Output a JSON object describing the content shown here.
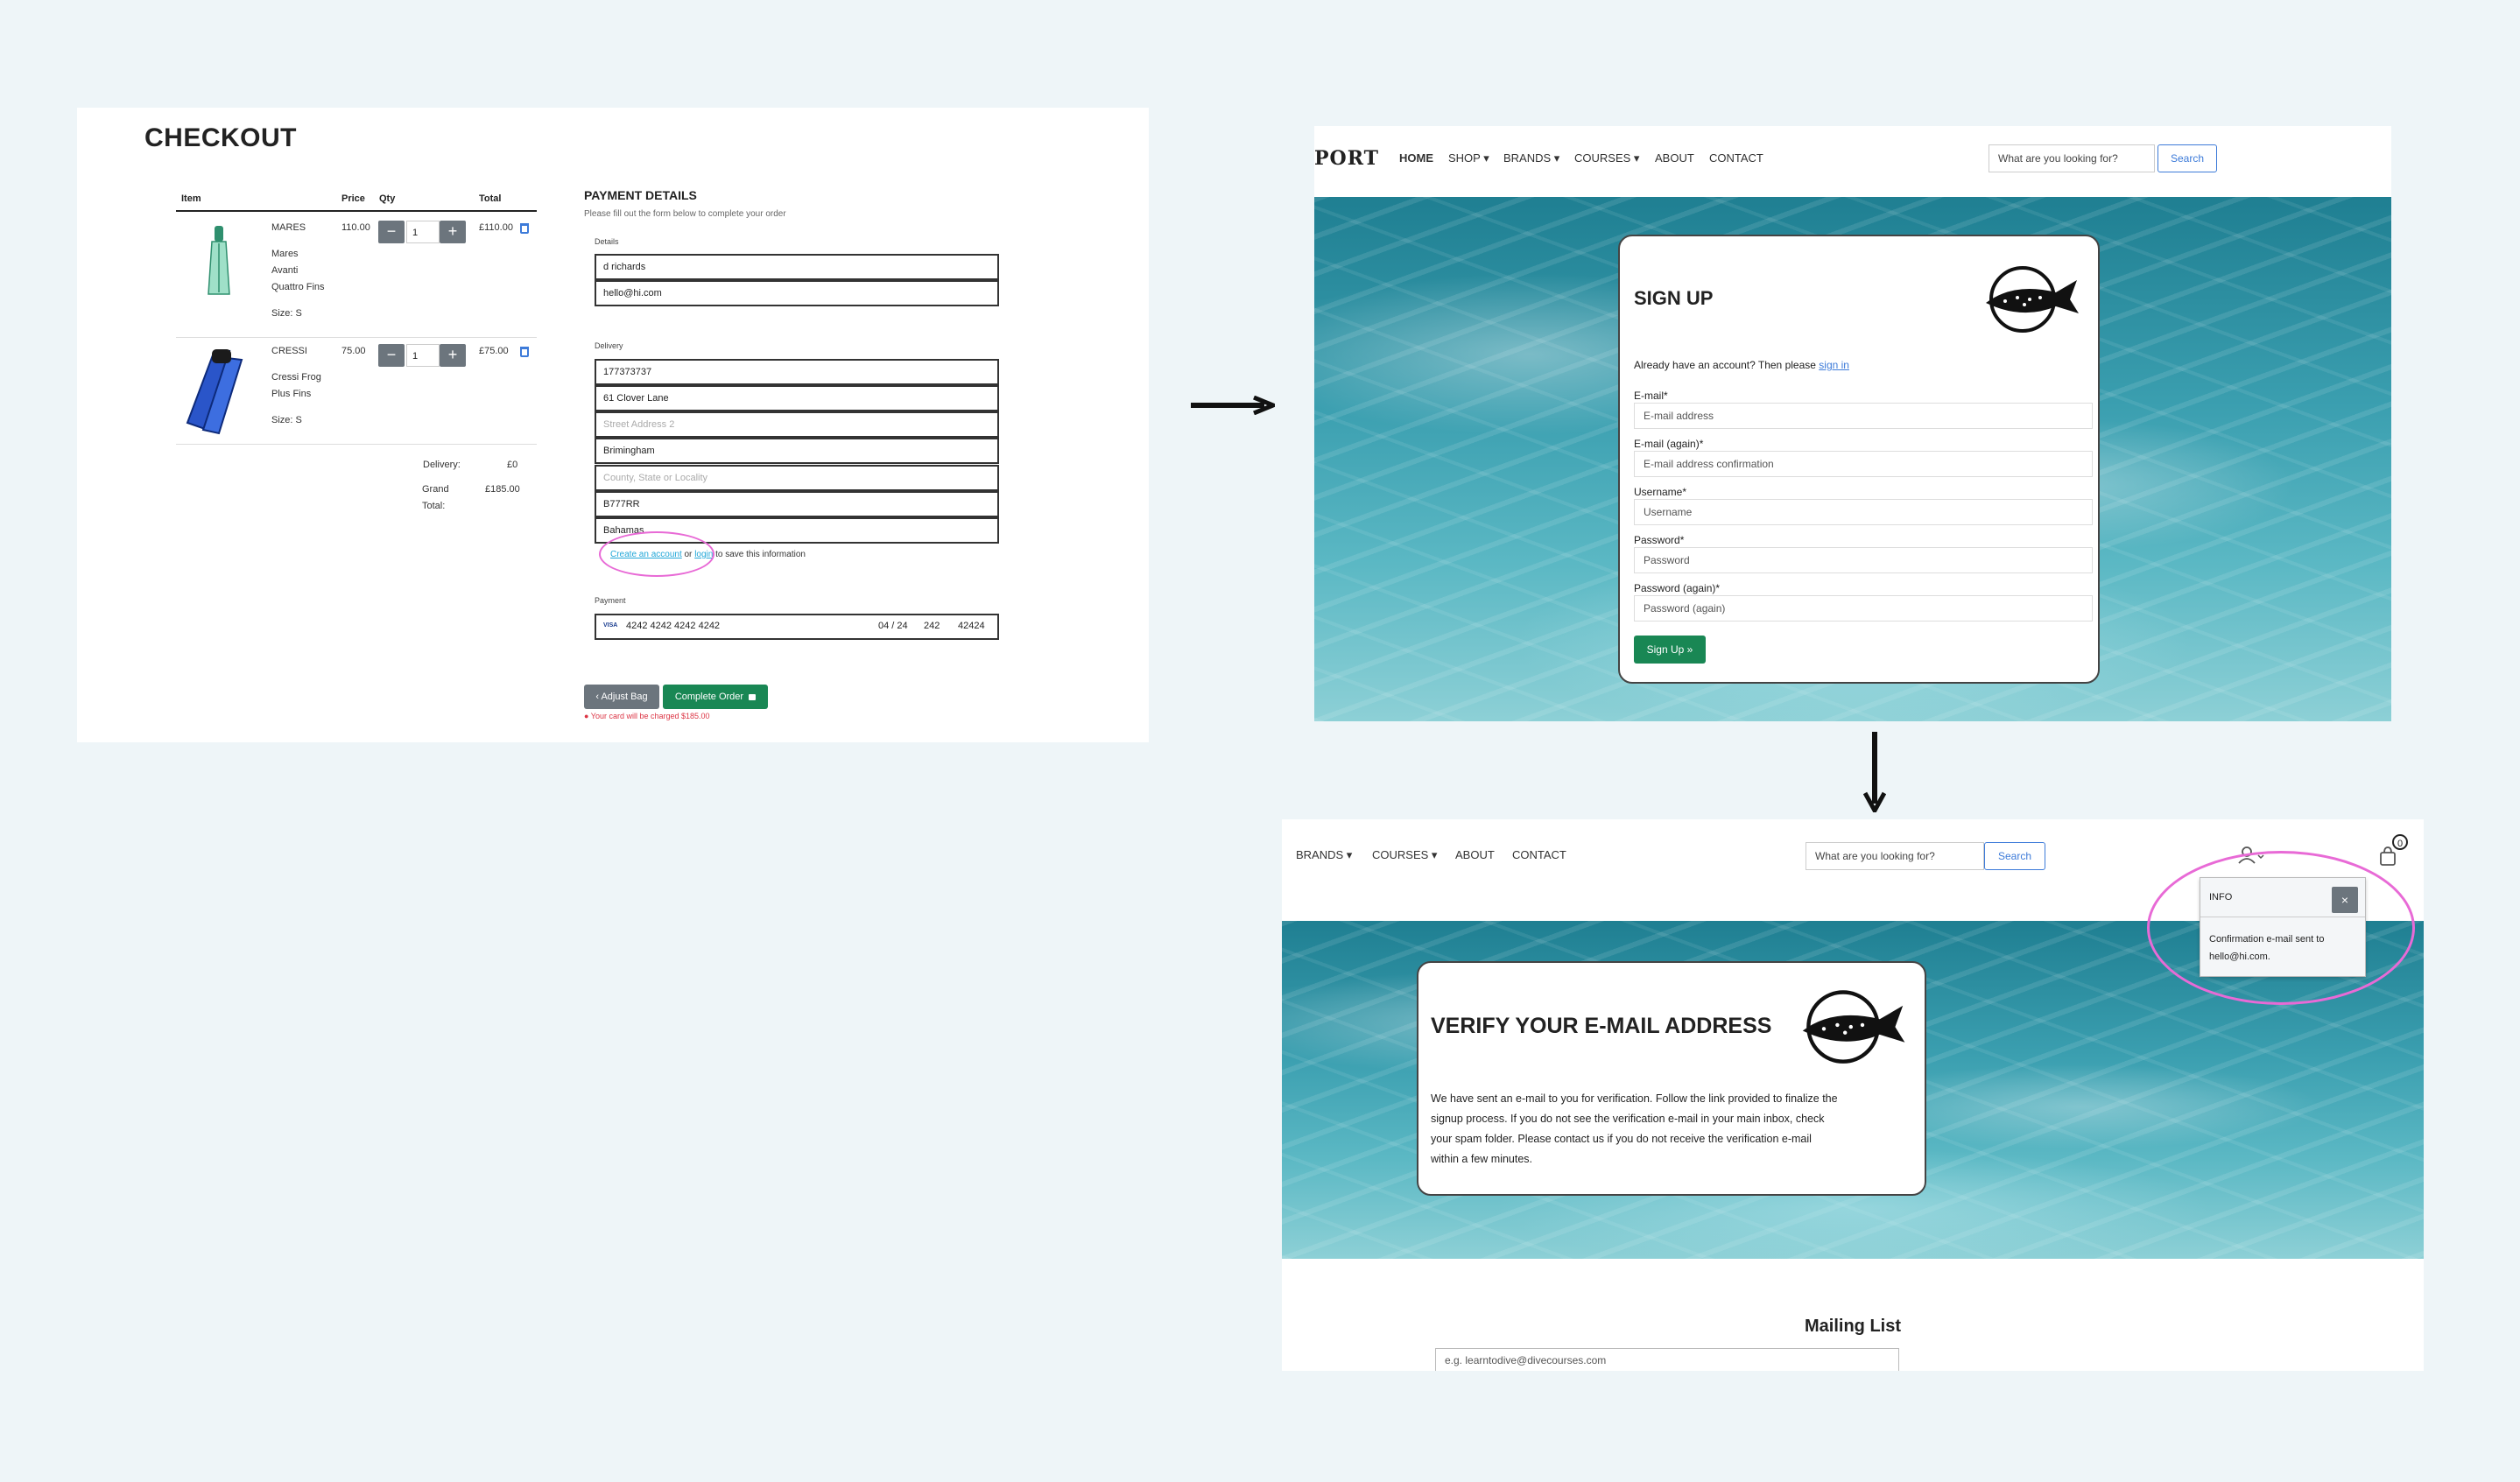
{
  "checkout": {
    "title": "CHECKOUT",
    "table_headers": [
      "Item",
      "Price",
      "Qty",
      "Total"
    ],
    "items": [
      {
        "brand": "MARES",
        "name_lines": [
          "Mares",
          "Avanti",
          "Quattro Fins"
        ],
        "size": "Size: S",
        "price": "110.00",
        "qty": "1",
        "total": "£110.00"
      },
      {
        "brand": "CRESSI",
        "name_lines": [
          "Cressi Frog",
          "Plus Fins"
        ],
        "size": "Size: S",
        "price": "75.00",
        "qty": "1",
        "total": "£75.00"
      }
    ],
    "qty_minus": "−",
    "qty_plus": "+",
    "delivery_label": "Delivery:",
    "delivery_value": "£0",
    "grand_total_label_1": "Grand",
    "grand_total_label_2": "Total:",
    "grand_total_value": "£185.00",
    "payment_details_title": "PAYMENT DETAILS",
    "payment_details_sub": "Please fill out the form below to complete your order",
    "details_label": "Details",
    "name_value": "d richards",
    "email_value": "hello@hi.com",
    "delivery_section_label": "Delivery",
    "phone_value": "177373737",
    "street1_value": "61 Clover Lane",
    "street2_placeholder": "Street Address 2",
    "town_value": "Brimingham",
    "county_placeholder": "County, State or Locality",
    "postcode_value": "B777RR",
    "country_value": "Bahamas",
    "create_account_link": "Create an account",
    "or_text": "or",
    "login_link": "login",
    "save_info_text": "to save this information",
    "payment_label": "Payment",
    "card_brand": "VISA",
    "card_number": "4242 4242 4242 4242",
    "card_expiry": "04 / 24",
    "card_cvc": "242",
    "card_zip": "42424",
    "adjust_bag_label": "Adjust Bag",
    "complete_order_label": "Complete Order",
    "charge_notice": "Your card will be charged",
    "charge_amount": "$185.00"
  },
  "signup": {
    "brand_partial": "PORT",
    "nav_items": [
      "HOME",
      "SHOP",
      "BRANDS",
      "COURSES",
      "ABOUT",
      "CONTACT"
    ],
    "search_placeholder": "What are you looking for?",
    "search_button": "Search",
    "title": "SIGN UP",
    "already_text": "Already have an account? Then please",
    "sign_in_link": "sign in",
    "fields": [
      {
        "label": "E-mail*",
        "placeholder": "E-mail address"
      },
      {
        "label": "E-mail (again)*",
        "placeholder": "E-mail address confirmation"
      },
      {
        "label": "Username*",
        "placeholder": "Username"
      },
      {
        "label": "Password*",
        "placeholder": "Password"
      },
      {
        "label": "Password (again)*",
        "placeholder": "Password (again)"
      }
    ],
    "submit_label": "Sign Up »"
  },
  "verify": {
    "nav_items": [
      "BRANDS",
      "COURSES",
      "ABOUT",
      "CONTACT"
    ],
    "search_placeholder": "What are you looking for?",
    "search_button": "Search",
    "cart_count": "0",
    "toast_title": "INFO",
    "toast_close": "×",
    "toast_message_1": "Confirmation e-mail sent to",
    "toast_message_2": "hello@hi.com.",
    "title": "VERIFY YOUR E-MAIL ADDRESS",
    "body_lines": [
      "We have sent an e-mail to you for verification. Follow the link provided to finalize the",
      "signup process. If you do not see the verification e-mail in your main inbox, check",
      "your spam folder. Please contact us if you do not receive the verification e-mail",
      "within a few minutes."
    ],
    "mailing_title": "Mailing List",
    "mailing_placeholder": "e.g. learntodive@divecourses.com"
  },
  "colors": {
    "background": "#eef5f8",
    "primary_blue": "#3d7bd9",
    "green": "#198754",
    "grey_button": "#6c757d",
    "highlight_circle": "#e86ad6",
    "danger": "#dc3545"
  }
}
